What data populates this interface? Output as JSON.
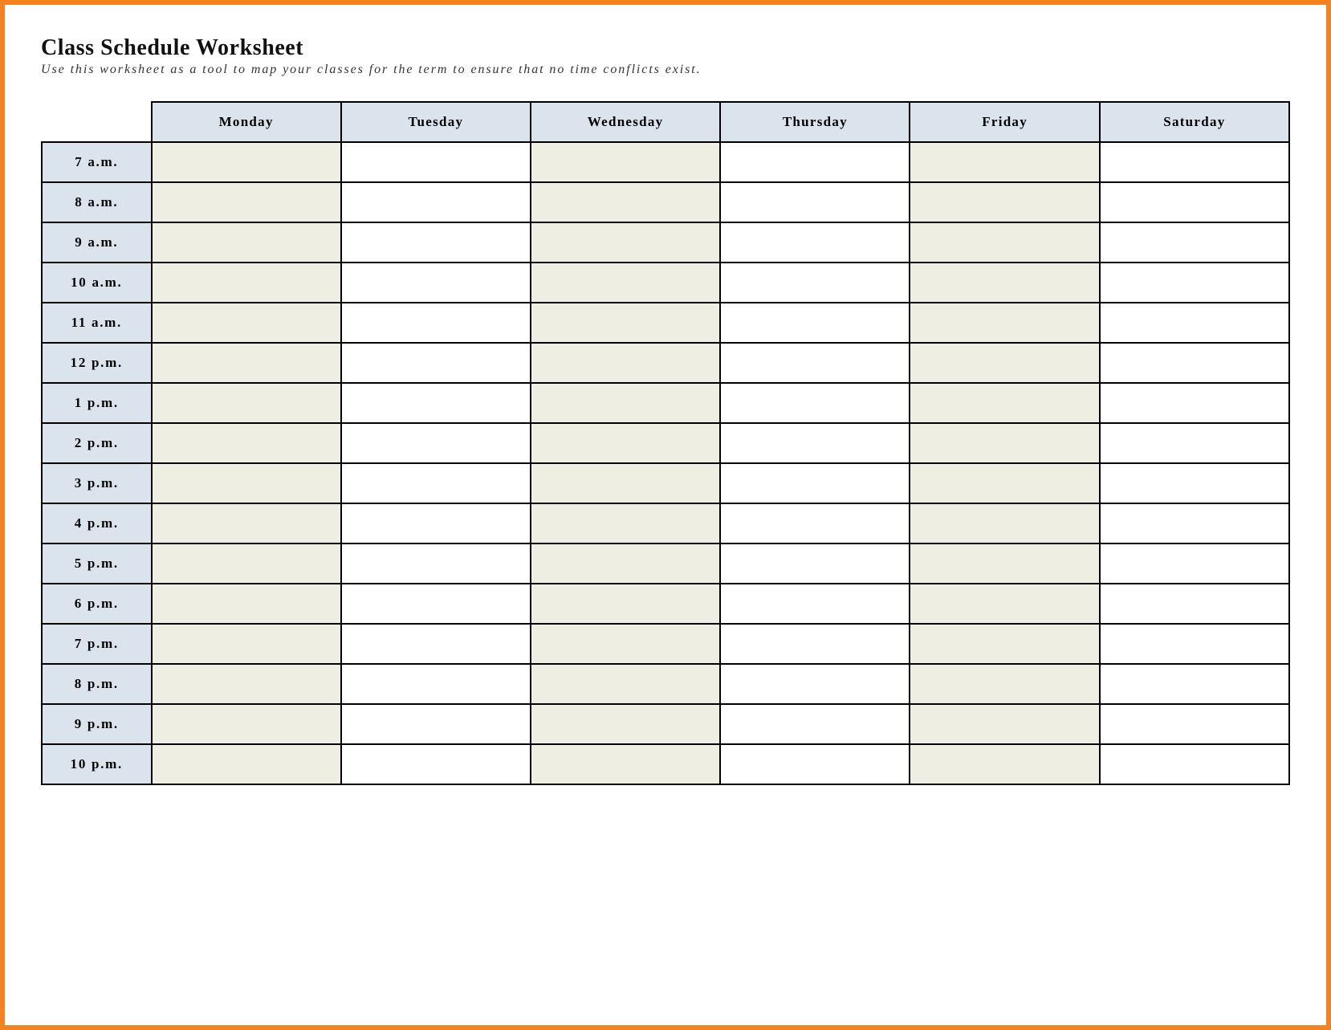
{
  "title": "Class Schedule Worksheet",
  "subtitle": "Use this worksheet as a tool to map your classes for the term to ensure that no time conflicts exist.",
  "days": [
    "Monday",
    "Tuesday",
    "Wednesday",
    "Thursday",
    "Friday",
    "Saturday"
  ],
  "times": [
    "7 a.m.",
    "8 a.m.",
    "9 a.m.",
    "10 a.m.",
    "11 a.m.",
    "12 p.m.",
    "1 p.m.",
    "2 p.m.",
    "3 p.m.",
    "4 p.m.",
    "5 p.m.",
    "6 p.m.",
    "7 p.m.",
    "8 p.m.",
    "9 p.m.",
    "10 p.m."
  ],
  "shaded_day_indices": [
    0,
    2,
    4
  ]
}
